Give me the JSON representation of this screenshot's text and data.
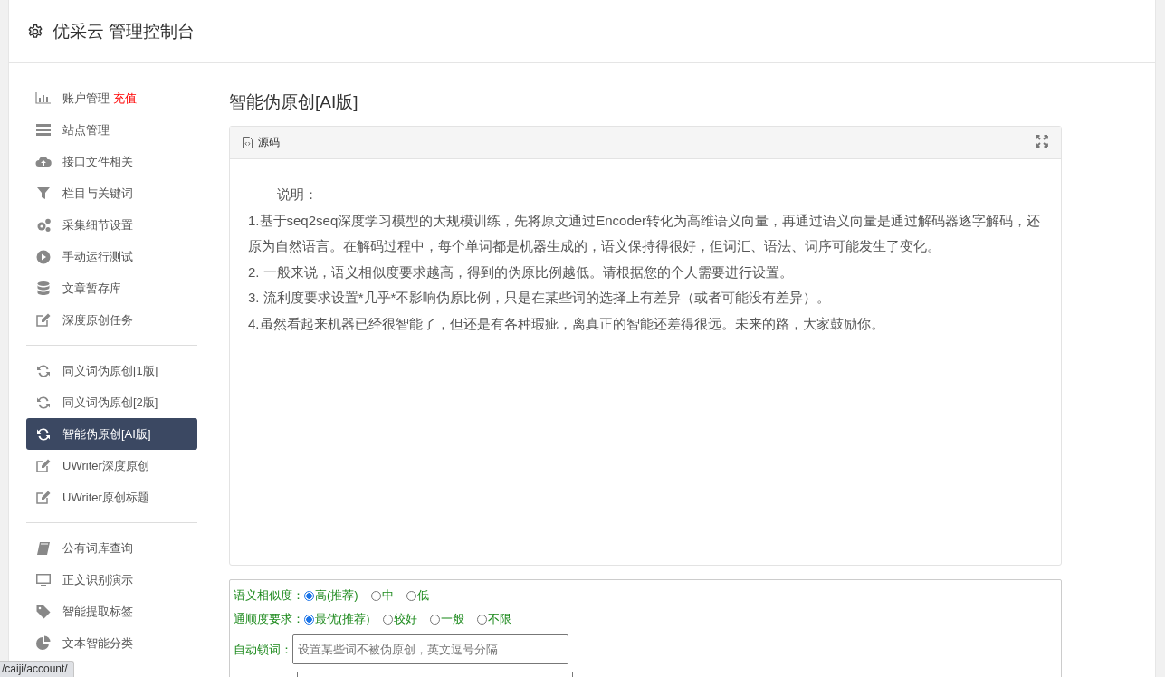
{
  "header": {
    "title": "优采云 管理控制台"
  },
  "sidebar": {
    "groups": [
      {
        "items": [
          {
            "label": "账户管理",
            "badge": "充值",
            "selected": false
          },
          {
            "label": "站点管理",
            "selected": false
          },
          {
            "label": "接口文件相关",
            "selected": false
          },
          {
            "label": "栏目与关键词",
            "selected": false
          },
          {
            "label": "采集细节设置",
            "selected": false
          },
          {
            "label": "手动运行测试",
            "selected": false
          },
          {
            "label": "文章暂存库",
            "selected": false
          },
          {
            "label": "深度原创任务",
            "selected": false
          }
        ]
      },
      {
        "items": [
          {
            "label": "同义词伪原创[1版]",
            "selected": false
          },
          {
            "label": "同义词伪原创[2版]",
            "selected": false
          },
          {
            "label": "智能伪原创[AI版]",
            "selected": true
          },
          {
            "label": "UWriter深度原创",
            "selected": false
          },
          {
            "label": "UWriter原创标题",
            "selected": false
          }
        ]
      },
      {
        "items": [
          {
            "label": "公有词库查询",
            "selected": false
          },
          {
            "label": "正文识别演示",
            "selected": false
          },
          {
            "label": "智能提取标签",
            "selected": false
          },
          {
            "label": "文本智能分类",
            "selected": false
          }
        ]
      }
    ]
  },
  "main": {
    "title": "智能伪原创[AI版]",
    "panel": {
      "tab": "源码",
      "heading": "说明：",
      "paragraphs": [
        "1.基于seq2seq深度学习模型的大规模训练，先将原文通过Encoder转化为高维语义向量，再通过语义向量是通过解码器逐字解码，还原为自然语言。在解码过程中，每个单词都是机器生成的，语义保持得很好，但词汇、语法、词序可能发生了变化。",
        "2. 一般来说，语义相似度要求越高，得到的伪原比例越低。请根据您的个人需要进行设置。",
        "3. 流利度要求设置*几乎*不影响伪原比例，只是在某些词的选择上有差异（或者可能没有差异）。",
        "4.虽然看起来机器已经很智能了，但还是有各种瑕疵，离真正的智能还差得很远。未来的路，大家鼓励你。"
      ]
    },
    "form": {
      "radio_groups": [
        {
          "label": "语义相似度：",
          "options": [
            {
              "label": "高(推荐)",
              "selected": true
            },
            {
              "label": "中",
              "selected": false
            },
            {
              "label": "低",
              "selected": false
            }
          ]
        },
        {
          "label": "通顺度要求：",
          "options": [
            {
              "label": "最优(推荐)",
              "selected": true
            },
            {
              "label": "较好",
              "selected": false
            },
            {
              "label": "一般",
              "selected": false
            },
            {
              "label": "不限",
              "selected": false
            }
          ]
        }
      ],
      "lock_words": {
        "label": "自动锁词：",
        "placeholder": "设置某些词不被伪原创，英文逗号分隔"
      }
    }
  },
  "status_bar": {
    "url": "/caiji/account/"
  }
}
